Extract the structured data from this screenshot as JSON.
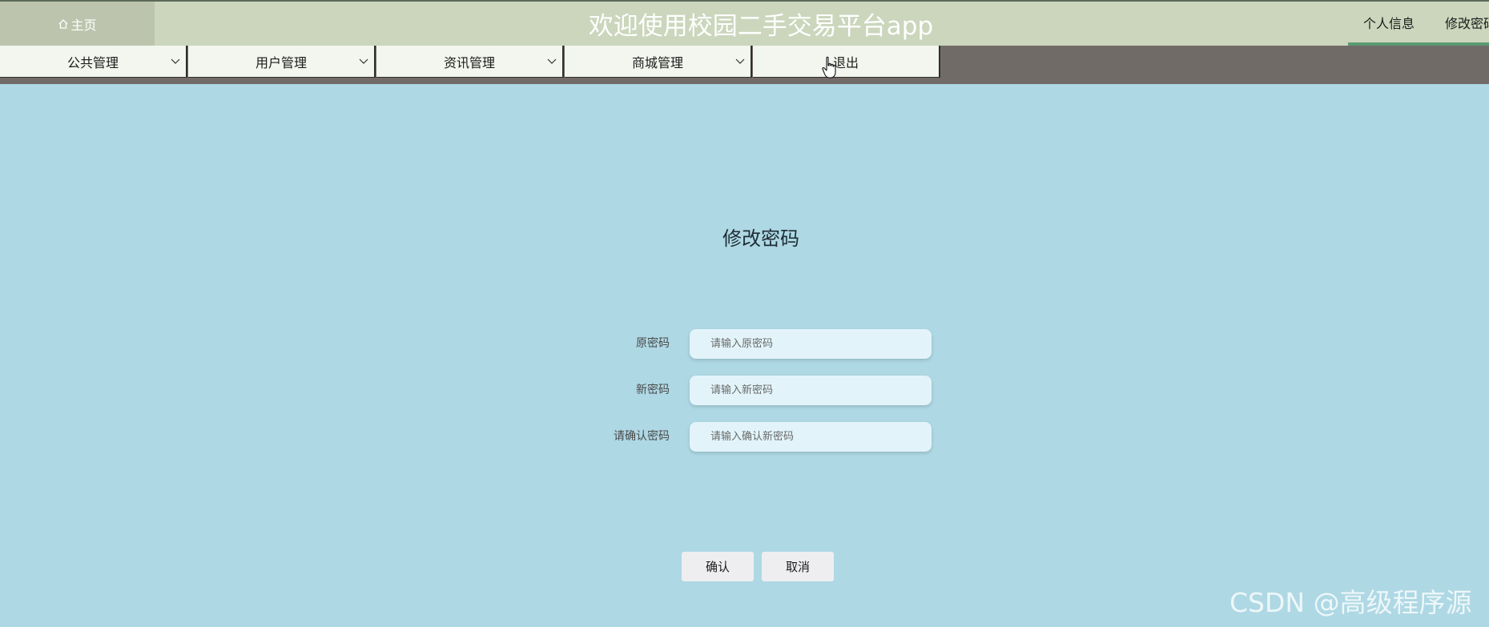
{
  "header": {
    "home_label": "主页",
    "app_title": "欢迎使用校园二手交易平台app",
    "user_menu": [
      {
        "label": "个人信息"
      },
      {
        "label": "修改密码"
      }
    ]
  },
  "nav": {
    "items": [
      {
        "label": "公共管理",
        "has_dropdown": true
      },
      {
        "label": "用户管理",
        "has_dropdown": true
      },
      {
        "label": "资讯管理",
        "has_dropdown": true
      },
      {
        "label": "商城管理",
        "has_dropdown": true
      },
      {
        "label": "退出",
        "has_dropdown": false
      }
    ]
  },
  "form": {
    "title": "修改密码",
    "fields": [
      {
        "label": "原密码",
        "placeholder": "请输入原密码",
        "value": ""
      },
      {
        "label": "新密码",
        "placeholder": "请输入新密码",
        "value": ""
      },
      {
        "label": "请确认密码",
        "placeholder": "请输入确认新密码",
        "value": ""
      }
    ],
    "confirm_label": "确认",
    "cancel_label": "取消"
  },
  "watermark": "CSDN @高级程序源",
  "colors": {
    "page_bg": "#aed8e4",
    "header_bg": "#cbd6bc",
    "nav_bar_bg": "#716b68",
    "nav_item_bg": "#f2f6ee",
    "input_bg": "#e2f4fa",
    "accent": "#5b9a72"
  },
  "icons": {
    "home": "home-icon",
    "dropdown": "chevron-down-icon",
    "cursor": "hand-pointer-cursor-icon"
  }
}
